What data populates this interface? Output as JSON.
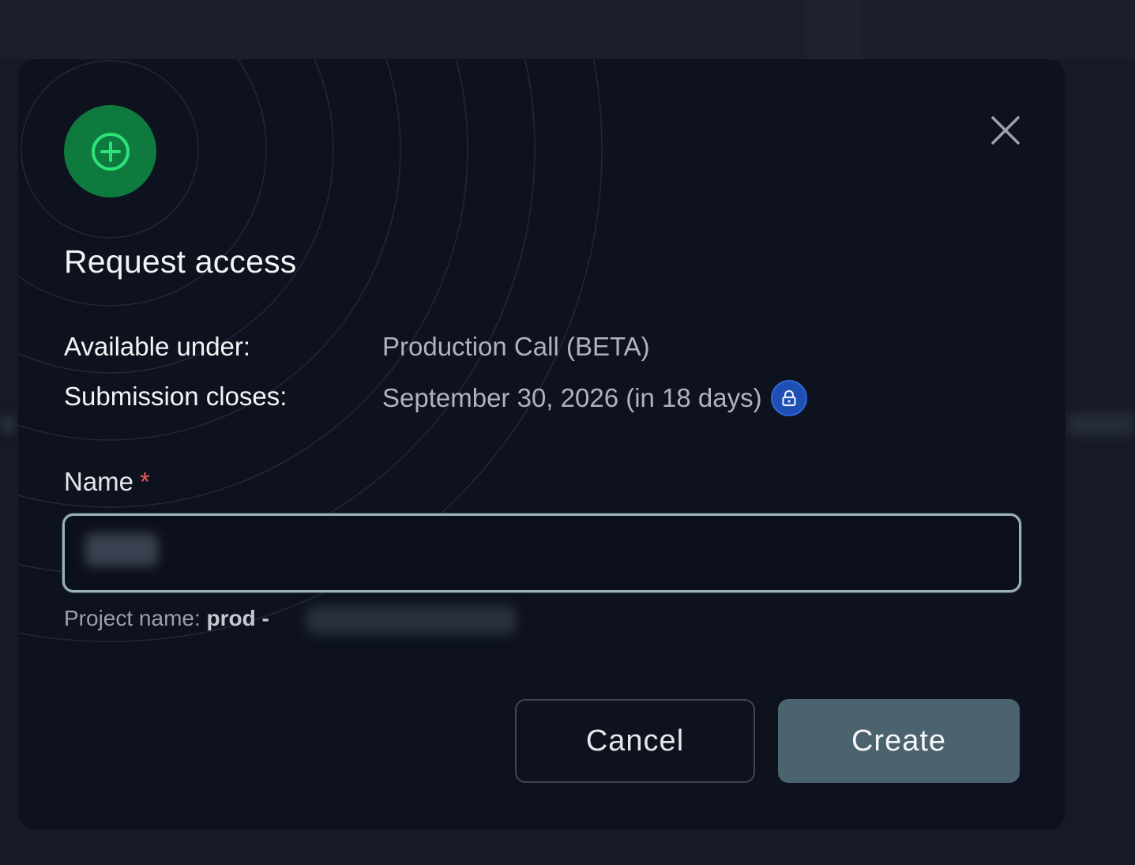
{
  "dialog": {
    "title": "Request access",
    "close_label": "Close",
    "info": {
      "available_under_label": "Available under:",
      "available_under_value": "Production Call (BETA)",
      "submission_closes_label": "Submission closes:",
      "submission_closes_value": "September 30, 2026 (in 18 days)"
    },
    "name_field": {
      "label": "Name",
      "required_marker": "*",
      "value": "",
      "hint_prefix": "Project name: ",
      "hint_bold": "prod -"
    },
    "buttons": {
      "cancel": "Cancel",
      "create": "Create"
    },
    "icons": {
      "badge": "plus-circle-icon",
      "close": "close-icon",
      "lock": "lock-icon"
    },
    "colors": {
      "badge_bg": "#0f7a3d",
      "badge_icon": "#2ee27a",
      "lock_bg": "#1f4fb5",
      "create_bg": "#4b626f",
      "required": "#ef5b5b"
    }
  }
}
